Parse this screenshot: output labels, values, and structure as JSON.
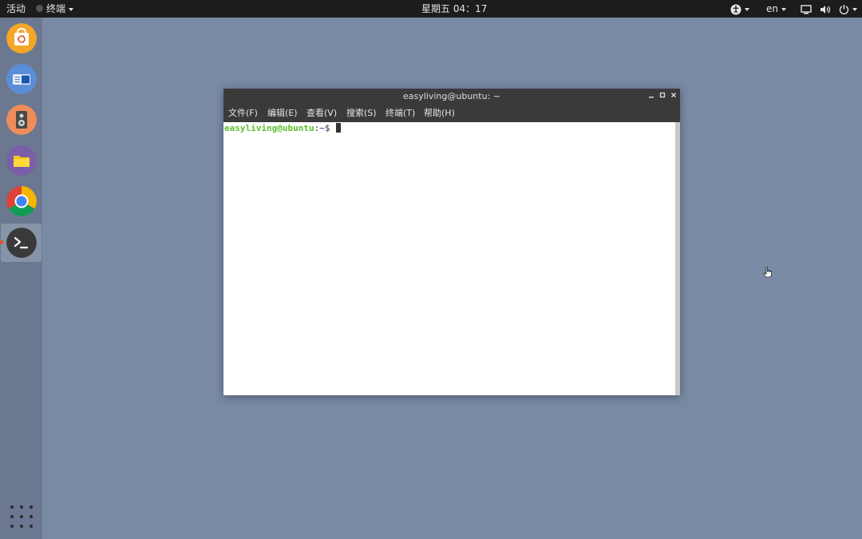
{
  "topbar": {
    "activities": "活动",
    "app_menu": "终端",
    "clock": "星期五 04：17",
    "lang": "en",
    "tray_icons": [
      "accessibility-icon",
      "language-icon",
      "network-icon",
      "volume-icon",
      "power-icon"
    ]
  },
  "dock": {
    "items": [
      {
        "name": "ubuntu-software-icon",
        "color": "#f4a629"
      },
      {
        "name": "remote-desktop-icon",
        "color": "#5b8ed8"
      },
      {
        "name": "rhythmbox-icon",
        "color": "#f08c5a"
      },
      {
        "name": "files-icon",
        "color": "#7a5ea8"
      },
      {
        "name": "chrome-icon",
        "color": "#4285f4"
      },
      {
        "name": "terminal-icon",
        "color": "#3a3a3a"
      }
    ],
    "apps_grid": "show-apps-icon"
  },
  "window": {
    "title": "easyliving@ubuntu: ~",
    "menu": [
      "文件(F)",
      "编辑(E)",
      "查看(V)",
      "搜索(S)",
      "终端(T)",
      "帮助(H)"
    ],
    "prompt": {
      "user_host": "easyliving@ubuntu",
      "colon": ":",
      "path": "~",
      "symbol": "$"
    }
  },
  "colors": {
    "desktop": "#798aa5",
    "topbar": "#1c1c1c",
    "dock": "#6b7890",
    "accent": "#e95420",
    "prompt_user": "#5bbe2b",
    "prompt_path": "#3465a4"
  }
}
